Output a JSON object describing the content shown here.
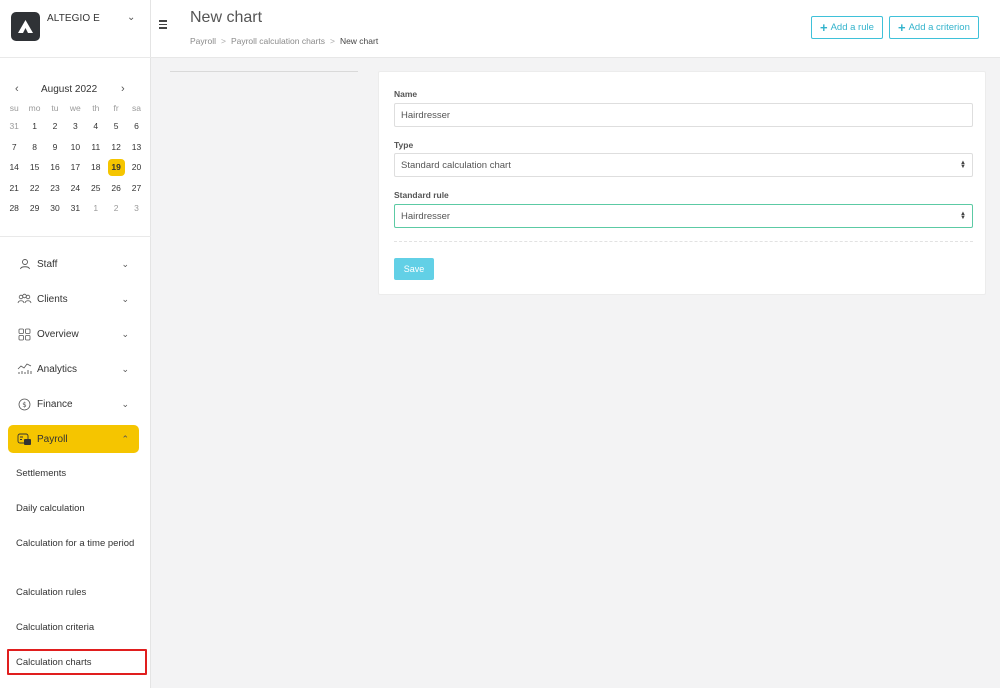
{
  "brand": {
    "name": "ALTEGIO E"
  },
  "calendar": {
    "title": "August 2022",
    "weekdays": [
      "su",
      "mo",
      "tu",
      "we",
      "th",
      "fr",
      "sa"
    ],
    "weeks": [
      [
        "31",
        "1",
        "2",
        "3",
        "4",
        "5",
        "6"
      ],
      [
        "7",
        "8",
        "9",
        "10",
        "11",
        "12",
        "13"
      ],
      [
        "14",
        "15",
        "16",
        "17",
        "18",
        "19",
        "20"
      ],
      [
        "21",
        "22",
        "23",
        "24",
        "25",
        "26",
        "27"
      ],
      [
        "28",
        "29",
        "30",
        "31",
        "1",
        "2",
        "3"
      ]
    ],
    "today": "19"
  },
  "nav": {
    "items": [
      {
        "label": "Staff",
        "icon": "user-icon"
      },
      {
        "label": "Clients",
        "icon": "clients-icon"
      },
      {
        "label": "Overview",
        "icon": "grid-icon"
      },
      {
        "label": "Analytics",
        "icon": "analytics-icon"
      },
      {
        "label": "Finance",
        "icon": "coin-icon"
      },
      {
        "label": "Payroll",
        "icon": "payroll-icon"
      }
    ],
    "payroll_sub": [
      "Settlements",
      "Daily calculation",
      "Calculation for a time period",
      "Calculation rules",
      "Calculation criteria",
      "Calculation charts"
    ]
  },
  "header": {
    "title": "New chart",
    "breadcrumb": [
      "Payroll",
      "Payroll calculation charts",
      "New chart"
    ],
    "add_rule": "Add a rule",
    "add_criterion": "Add a criterion"
  },
  "form": {
    "name_label": "Name",
    "name_value": "Hairdresser",
    "type_label": "Type",
    "type_value": "Standard calculation chart",
    "rule_label": "Standard rule",
    "rule_value": "Hairdresser",
    "save": "Save"
  },
  "colors": {
    "accent": "#f5c500",
    "primary": "#3fc1d9",
    "highlight": "#e01e1e"
  }
}
